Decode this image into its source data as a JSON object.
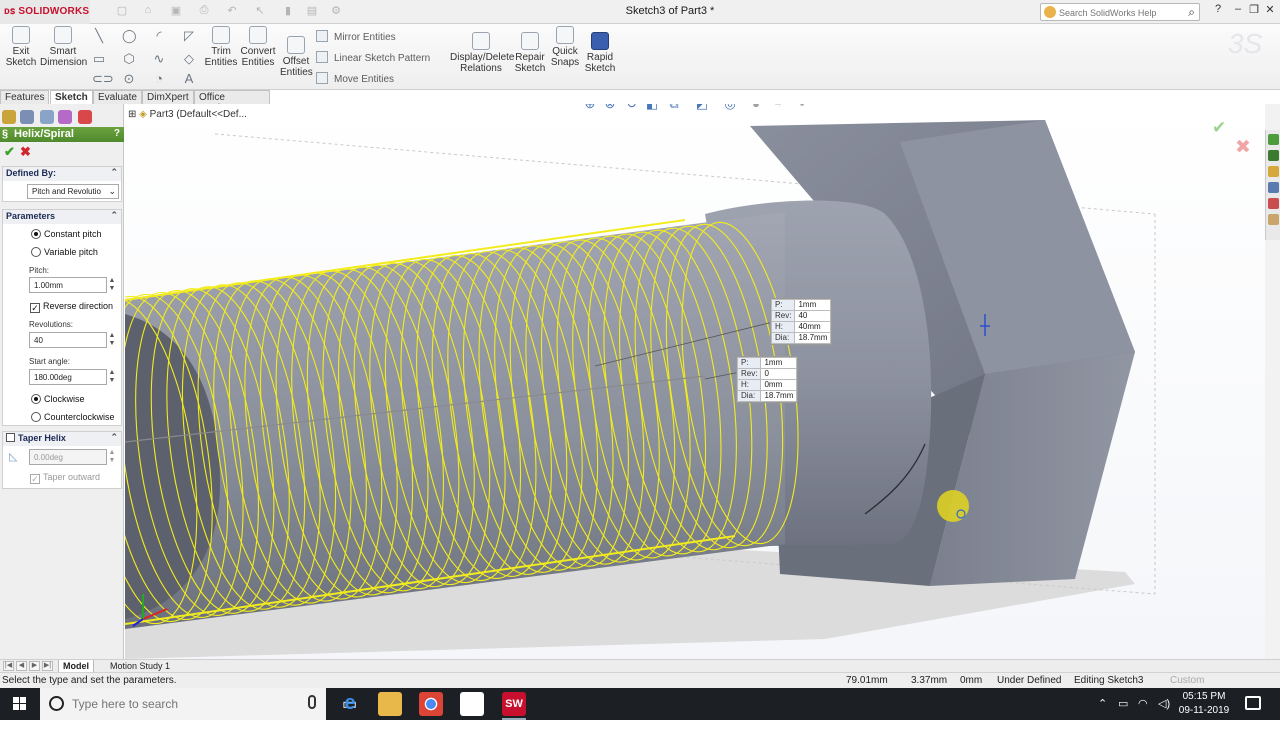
{
  "app": {
    "logo": "SOLIDWORKS",
    "document_title": "Sketch3 of Part3 *",
    "help_search_placeholder": "Search SolidWorks Help"
  },
  "toolbar": {
    "exit_sketch": "Exit\nSketch",
    "smart_dimension": "Smart\nDimension",
    "trim_entities": "Trim\nEntities",
    "convert_entities": "Convert\nEntities",
    "offset_entities": "Offset\nEntities",
    "mirror_entities": "Mirror Entities",
    "linear_sketch_pattern": "Linear Sketch Pattern",
    "move_entities": "Move Entities",
    "display_delete_relations": "Display/Delete\nRelations",
    "repair_sketch": "Repair\nSketch",
    "quick_snaps": "Quick\nSnaps",
    "rapid_sketch": "Rapid\nSketch"
  },
  "tabs": [
    "Features",
    "Sketch",
    "Evaluate",
    "DimXpert",
    "Office Products"
  ],
  "active_tab": "Sketch",
  "panel": {
    "title": "Helix/Spiral",
    "help": "?",
    "defined_by": {
      "heading": "Defined By:",
      "value": "Pitch and Revolutio"
    },
    "parameters": {
      "heading": "Parameters",
      "constant_pitch": "Constant pitch",
      "variable_pitch": "Variable pitch",
      "pitch_label": "Pitch:",
      "pitch_value": "1.00mm",
      "reverse_direction": "Reverse direction",
      "revolutions_label": "Revolutions:",
      "revolutions_value": "40",
      "start_angle_label": "Start angle:",
      "start_angle_value": "180.00deg",
      "clockwise": "Clockwise",
      "counterclockwise": "Counterclockwise"
    },
    "taper": {
      "heading": "Taper Helix",
      "angle_value": "0.00deg",
      "taper_outward": "Taper outward"
    }
  },
  "viewport": {
    "tree_path": "Part3  (Default<<Def...",
    "callout_end": {
      "p_label": "P:",
      "p_value": "1mm",
      "rev_label": "Rev:",
      "rev_value": "40",
      "h_label": "H:",
      "h_value": "40mm",
      "dia_label": "Dia:",
      "dia_value": "18.7mm"
    },
    "callout_start": {
      "p_label": "P:",
      "p_value": "1mm",
      "rev_label": "Rev:",
      "rev_value": "0",
      "h_label": "H:",
      "h_value": "0mm",
      "dia_label": "Dia:",
      "dia_value": "18.7mm"
    }
  },
  "bottom_tabs": [
    "Model",
    "Motion Study 1"
  ],
  "status": {
    "message": "Select the type and set the parameters.",
    "x": "79.01mm",
    "y": "3.37mm",
    "z": "0mm",
    "state": "Under Defined",
    "editing": "Editing Sketch3",
    "custom": "Custom"
  },
  "taskbar": {
    "search_placeholder": "Type here to search",
    "time": "05:15 PM",
    "date": "09-11-2019"
  },
  "colors": {
    "helix": "#f2ec1c",
    "model_body": "#808696",
    "brand_red": "#c8102e"
  }
}
